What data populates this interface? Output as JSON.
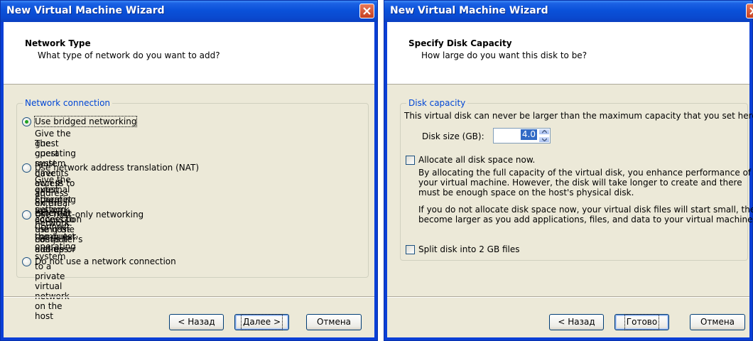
{
  "left_window": {
    "title": "New Virtual Machine Wizard",
    "header": {
      "title": "Network Type",
      "subtitle": "What type of network do you want to add?"
    },
    "group": {
      "legend": "Network connection",
      "options": [
        {
          "label": "Use bridged networking",
          "checked": true,
          "desc1": "Give the guest operating system direct access to an external Ethernet network.",
          "desc2": "The guest must have its own IP address on the external network."
        },
        {
          "label": "Use network address translation (NAT)",
          "checked": false,
          "desc1": "Give the guest operating system access to the host computer's dial-up or",
          "desc2": "external Ethernet network connection using the host's IP address."
        },
        {
          "label": "Use host-only networking",
          "checked": false,
          "desc1": "Connect the guest operating system to a private virtual network on the host",
          "desc2": "computer."
        },
        {
          "label": "Do not use a network connection",
          "checked": false
        }
      ]
    },
    "buttons": {
      "back": "< Назад",
      "next": "Далее >",
      "cancel": "Отмена"
    }
  },
  "right_window": {
    "title": "New Virtual Machine Wizard",
    "header": {
      "title": "Specify Disk Capacity",
      "subtitle": "How large do you want this disk to be?"
    },
    "group": {
      "legend": "Disk capacity",
      "intro": "This virtual disk can never be larger than the maximum capacity that you set here.",
      "disk_size_label": "Disk size (GB):",
      "disk_size_value": "4.0",
      "allocate": {
        "label": "Allocate all disk space now.",
        "checked": false,
        "desc1": "By allocating the full capacity of the virtual disk, you enhance performance of",
        "desc2": "your virtual machine.  However, the disk will take longer to create and there",
        "desc3": "must be enough space on the host's physical disk.",
        "desc4": "If you do not allocate disk space now, your virtual disk files will start small, then",
        "desc5": "become larger as you add applications, files, and data to your virtual machine."
      },
      "split": {
        "label": "Split disk into 2 GB files",
        "checked": false
      }
    },
    "buttons": {
      "back": "< Назад",
      "finish": "Готово",
      "cancel": "Отмена"
    }
  },
  "colors": {
    "title_bar": "#0a51d9",
    "close_button": "#d9573a",
    "legend_text": "#0046d5",
    "radio_dot": "#21a121",
    "face": "#ece9d8"
  },
  "icons": {
    "close": "close-icon",
    "spin_up": "chevron-up-icon",
    "spin_down": "chevron-down-icon"
  }
}
